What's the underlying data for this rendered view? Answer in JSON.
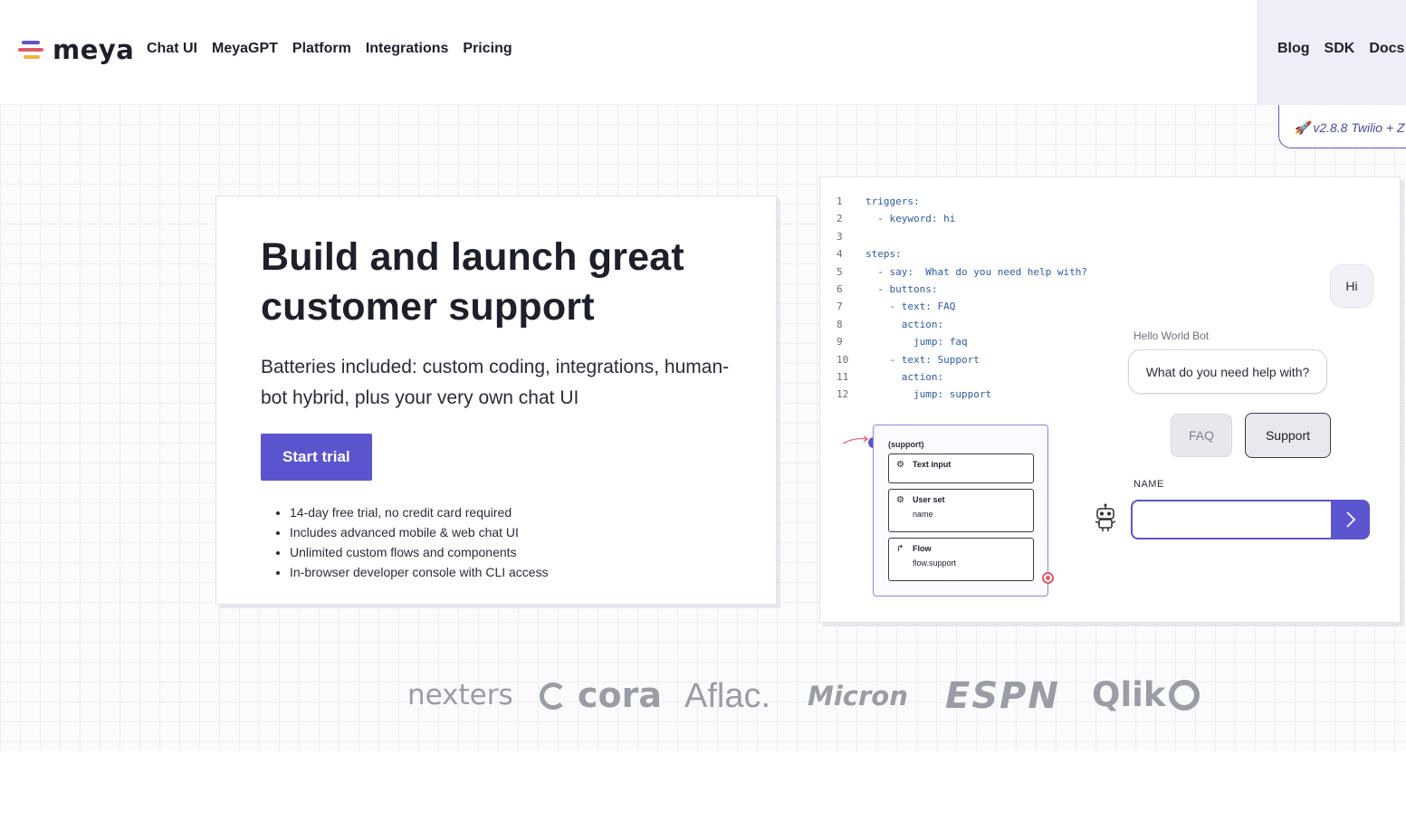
{
  "brand": {
    "name": "meya",
    "colors": {
      "accent": "#5a55cf",
      "bar1": "#5a55cf",
      "bar2": "#e05a6a",
      "bar3": "#f0b43c"
    }
  },
  "nav": {
    "items": [
      "Chat UI",
      "MeyaGPT",
      "Platform",
      "Integrations",
      "Pricing"
    ],
    "right": [
      "Blog",
      "SDK",
      "Docs"
    ]
  },
  "version_badge": "🚀 v2.8.8 Twilio + Z",
  "hero": {
    "title": "Build and launch great customer support",
    "subtitle": "Batteries included: custom coding, integrations, human-bot hybrid, plus your very own chat UI",
    "cta": "Start trial",
    "bullets": [
      "14-day free trial, no credit card required",
      "Includes advanced mobile & web chat UI",
      "Unlimited custom flows and components",
      "In-browser developer console with CLI access"
    ]
  },
  "code": [
    {
      "n": "1",
      "t": "triggers:"
    },
    {
      "n": "2",
      "t": "  - keyword: hi"
    },
    {
      "n": "3",
      "t": ""
    },
    {
      "n": "4",
      "t": "steps:"
    },
    {
      "n": "5",
      "t": "  - say:  What do you need help with?"
    },
    {
      "n": "6",
      "t": "  - buttons:"
    },
    {
      "n": "7",
      "t": "    - text: FAQ"
    },
    {
      "n": "8",
      "t": "      action:"
    },
    {
      "n": "9",
      "t": "        jump: faq"
    },
    {
      "n": "10",
      "t": "    - text: Support"
    },
    {
      "n": "11",
      "t": "      action:"
    },
    {
      "n": "12",
      "t": "        jump: support"
    }
  ],
  "flow": {
    "title": "(support)",
    "nodes": [
      {
        "label": "Text input",
        "sub": ""
      },
      {
        "label": "User set",
        "sub": "name"
      },
      {
        "label": "Flow",
        "sub": "flow.support"
      }
    ]
  },
  "chat": {
    "user_message": "Hi",
    "bot_name": "Hello World Bot",
    "bot_message": "What do you need help with?",
    "buttons": [
      "FAQ",
      "Support"
    ],
    "input_label": "NAME",
    "input_value": ""
  },
  "customer_logos": [
    "nexters",
    "cora",
    "Aflac.",
    "Micron",
    "ESPN",
    "Qlik"
  ]
}
